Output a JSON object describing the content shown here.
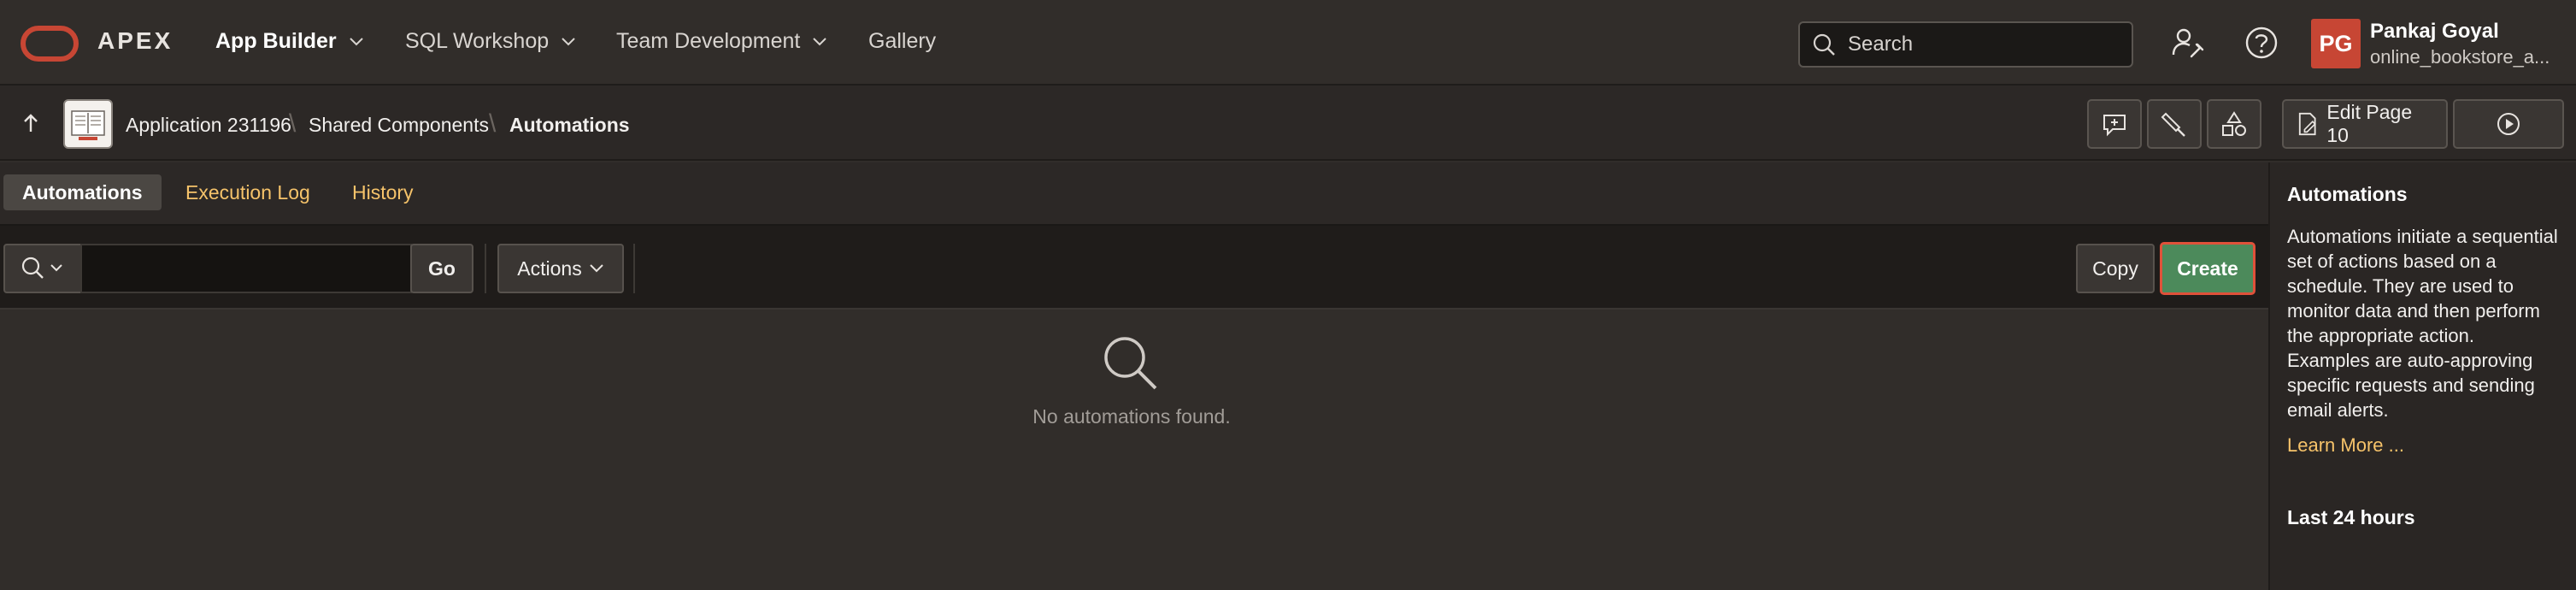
{
  "header": {
    "brand": "APEX",
    "nav": [
      {
        "label": "App Builder",
        "active": true
      },
      {
        "label": "SQL Workshop"
      },
      {
        "label": "Team Development"
      },
      {
        "label": "Gallery"
      }
    ],
    "search_placeholder": "Search",
    "user": {
      "initials": "PG",
      "name": "Pankaj Goyal",
      "workspace": "online_bookstore_a..."
    }
  },
  "breadcrumb": {
    "items": [
      "Application 231196",
      "Shared Components",
      "Automations"
    ],
    "edit_page_label": "Edit Page 10"
  },
  "tabs": [
    "Automations",
    "Execution Log",
    "History"
  ],
  "toolbar": {
    "search_value": "",
    "go_label": "Go",
    "actions_label": "Actions",
    "copy_label": "Copy",
    "create_label": "Create"
  },
  "empty_state": {
    "message": "No automations found."
  },
  "help_panel": {
    "title": "Automations",
    "body": "Automations initiate a sequential set of actions based on a schedule. They are used to monitor data and then perform the appropriate action. Examples are auto-approving specific requests and sending email alerts.",
    "link": "Learn More ...",
    "subheading": "Last 24 hours"
  },
  "colors": {
    "brand_red": "#c74634",
    "create_green": "#4c8a5b",
    "link_gold": "#f6c36a",
    "create_focus_outline": "#e0513a"
  }
}
